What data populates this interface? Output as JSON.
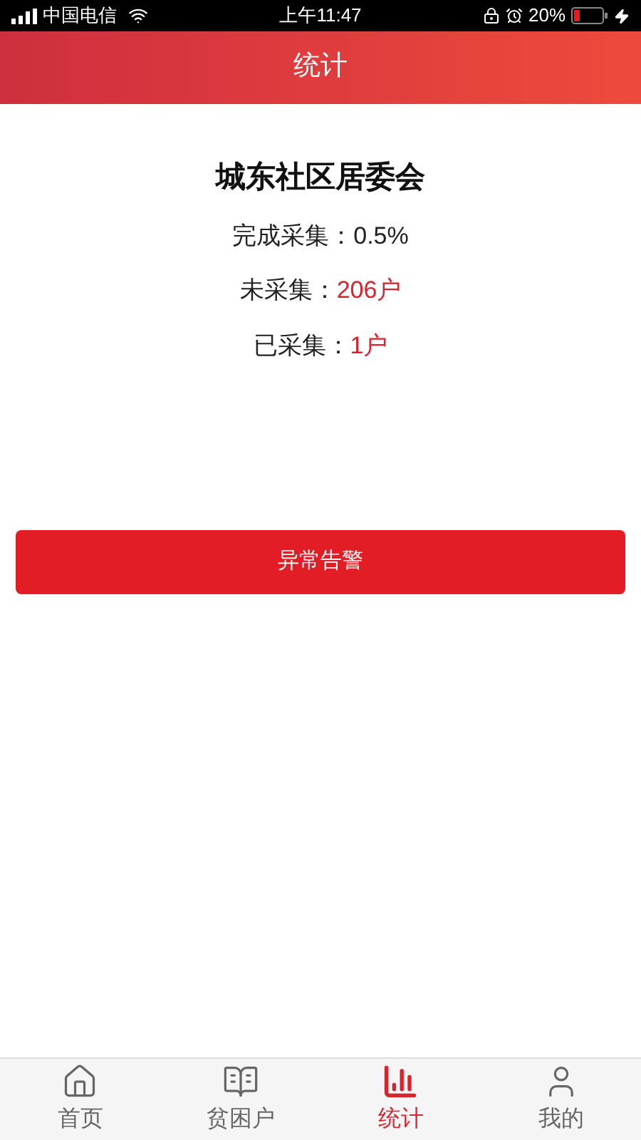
{
  "status_bar": {
    "carrier": "中国电信",
    "time": "上午11:47",
    "battery": "20%"
  },
  "header": {
    "title": "统计"
  },
  "org": {
    "name": "城东社区居委会"
  },
  "stats": [
    {
      "label": "完成采集：",
      "value": "0.5%",
      "highlight": false
    },
    {
      "label": "未采集：",
      "value": "206户",
      "highlight": true
    },
    {
      "label": "已采集：",
      "value": "1户",
      "highlight": true
    }
  ],
  "alert_button": {
    "label": "异常告警"
  },
  "tabs": [
    {
      "label": "首页",
      "selected": false
    },
    {
      "label": "贫困户",
      "selected": false
    },
    {
      "label": "统计",
      "selected": true
    },
    {
      "label": "我的",
      "selected": false
    }
  ]
}
